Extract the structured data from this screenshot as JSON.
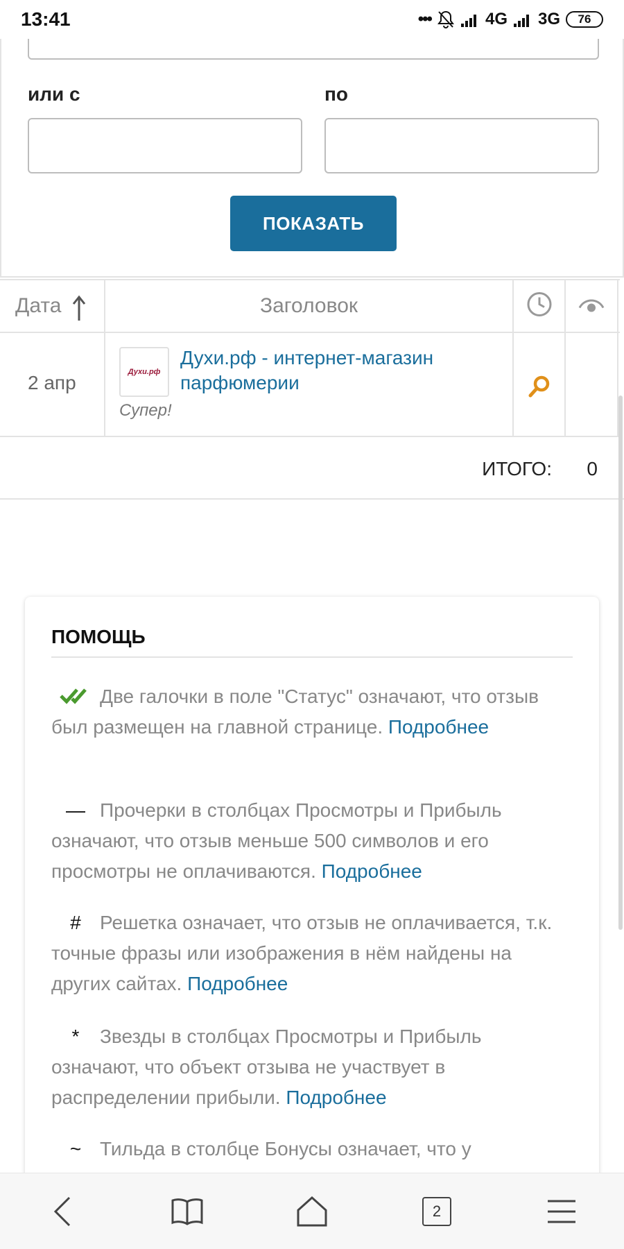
{
  "status_bar": {
    "time": "13:41",
    "dots": "•••",
    "network_1": "4G",
    "network_2": "3G",
    "battery": "76"
  },
  "form": {
    "from_label": "или с",
    "to_label": "по",
    "from_value": "",
    "to_value": "",
    "show_button": "ПОКАЗАТЬ"
  },
  "table": {
    "headers": {
      "date": "Дата",
      "title": "Заголовок"
    },
    "rows": [
      {
        "date": "2 апр",
        "thumb_logo": "Духи.рф",
        "title": "Духи.рф - интернет-магазин парфюмерии",
        "comment": "Супер!"
      }
    ],
    "total_label": "ИТОГО:",
    "total_value": "0"
  },
  "help": {
    "title": "ПОМОЩЬ",
    "items": [
      {
        "symbol": "✔✔",
        "text": "Две галочки в поле \"Статус\" означают, что отзыв был размещен на главной странице.",
        "link": "Подробнее"
      },
      {
        "symbol": "—",
        "text": "Прочерки в столбцах Просмотры и Прибыль означают, что отзыв меньше 500 символов и его просмотры не оплачиваются.",
        "link": "Подробнее"
      },
      {
        "symbol": "#",
        "text": "Решетка означает, что отзыв не оплачивается, т.к. точные фразы или изображения в нём найдены на других сайтах.",
        "link": "Подробнее"
      },
      {
        "symbol": "*",
        "text": "Звезды в столбцах Просмотры и Прибыль означают, что объект отзыва не участвует в распределении прибыли.",
        "link": "Подробнее"
      },
      {
        "symbol": "~",
        "text": "Тильда в столбце Бонусы означает, что у",
        "link": ""
      }
    ]
  },
  "bottom_nav": {
    "tabs_count": "2"
  },
  "colors": {
    "accent": "#1a6e9c",
    "check_green": "#4a9a2e",
    "search_orange": "#e0901a"
  }
}
